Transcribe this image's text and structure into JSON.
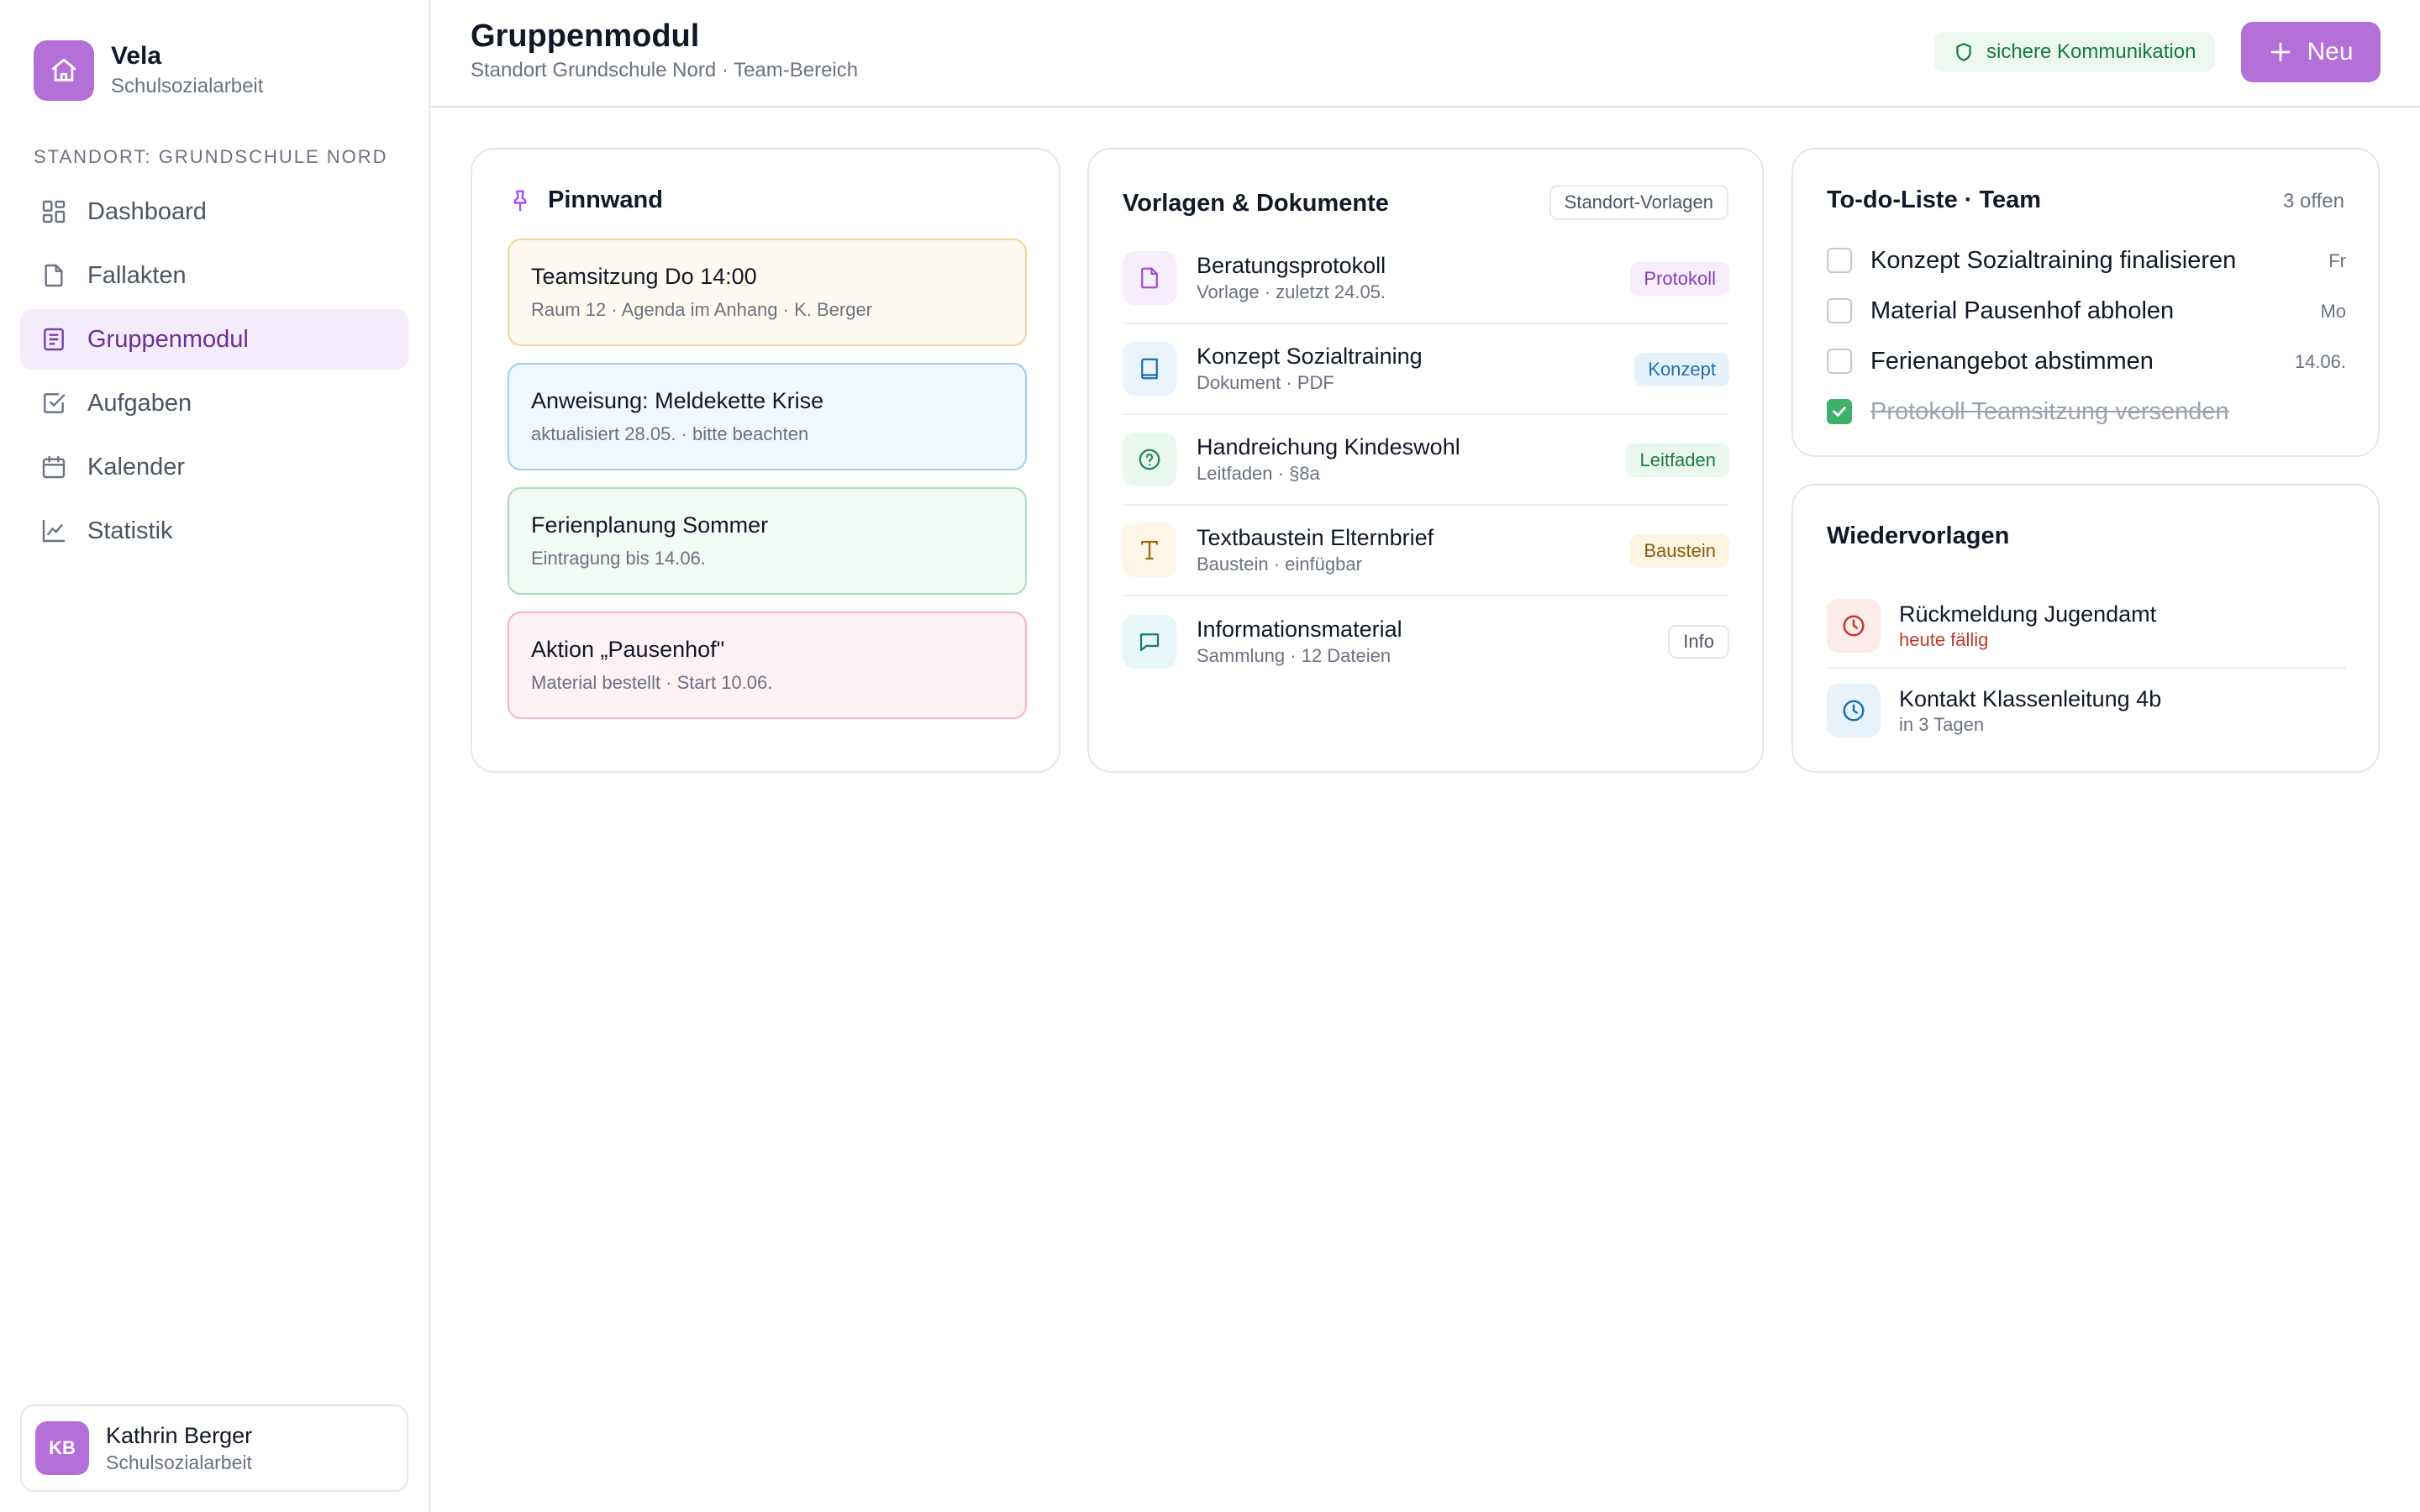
{
  "brand": {
    "name": "Vela",
    "subtitle": "Schulsozialarbeit",
    "accent": "#b46fd8"
  },
  "sidebar": {
    "section_label": "Standort: Grundschule Nord",
    "items": [
      {
        "label": "Dashboard",
        "icon": "dashboard-icon",
        "active": false
      },
      {
        "label": "Fallakten",
        "icon": "file-icon",
        "active": false
      },
      {
        "label": "Gruppenmodul",
        "icon": "group-module-icon",
        "active": true
      },
      {
        "label": "Aufgaben",
        "icon": "checklist-icon",
        "active": false
      },
      {
        "label": "Kalender",
        "icon": "calendar-icon",
        "active": false
      },
      {
        "label": "Statistik",
        "icon": "chart-icon",
        "active": false
      }
    ],
    "user": {
      "initials": "KB",
      "name": "Kathrin Berger",
      "role": "Schulsozialarbeit"
    }
  },
  "header": {
    "title": "Gruppenmodul",
    "subtitle": "Standort Grundschule Nord · Team-Bereich",
    "badge": "sichere Kommunikation",
    "new_button": "Neu"
  },
  "pinboard": {
    "title": "Pinnwand",
    "notes": [
      {
        "title": "Teamsitzung Do 14:00",
        "meta": "Raum 12 · Agenda im Anhang · K. Berger",
        "bg": "#fffaf1",
        "border": "#f6d49a"
      },
      {
        "title": "Anweisung: Meldekette Krise",
        "meta": "aktualisiert 28.05. · bitte beachten",
        "bg": "#f0f7fe",
        "border": "#9fcdf2"
      },
      {
        "title": "Ferienplanung Sommer",
        "meta": "Eintragung bis 14.06.",
        "bg": "#f1faf4",
        "border": "#a9dcbb"
      },
      {
        "title": "Aktion „Pausenhof\"",
        "meta": "Material bestellt · Start 10.06.",
        "bg": "#fff2f5",
        "border": "#f5b3c3"
      }
    ]
  },
  "documents": {
    "title": "Vorlagen & Dokumente",
    "chip": "Standort-Vorlagen",
    "rows": [
      {
        "name": "Beratungsprotokoll",
        "meta": "Vorlage · zuletzt 24.05.",
        "tag": "Protokoll",
        "icon": "document-icon",
        "icon_bg": "#f6eefc",
        "icon_color": "#9d4fd0",
        "tag_bg": "#f6eefc",
        "tag_color": "#8a3cba"
      },
      {
        "name": "Konzept Sozialtraining",
        "meta": "Dokument · PDF",
        "tag": "Konzept",
        "icon": "book-icon",
        "icon_bg": "#eaf4fc",
        "icon_color": "#1f6fae",
        "tag_bg": "#e6f2fb",
        "tag_color": "#1f6fae"
      },
      {
        "name": "Handreichung Kindeswohl",
        "meta": "Leitfaden · §8a",
        "tag": "Leitfaden",
        "icon": "help-circle-icon",
        "icon_bg": "#eaf7ef",
        "icon_color": "#1f8a4c",
        "tag_bg": "#e9f7ee",
        "tag_color": "#1f7a44"
      },
      {
        "name": "Textbaustein Elternbrief",
        "meta": "Baustein · einfügbar",
        "tag": "Baustein",
        "icon": "text-icon",
        "icon_bg": "#fdf5e6",
        "icon_color": "#9a6a12",
        "tag_bg": "#fdf5e3",
        "tag_color": "#8a5d0c"
      },
      {
        "name": "Informationsmaterial",
        "meta": "Sammlung · 12 Dateien",
        "tag": "Info",
        "icon": "message-icon",
        "icon_bg": "#e7f6f6",
        "icon_color": "#157a7a",
        "tag_bg": "#ffffff",
        "tag_color": "#4b5563"
      }
    ]
  },
  "todo": {
    "title": "To-do-Liste · Team",
    "count": "3 offen",
    "items": [
      {
        "label": "Konzept Sozialtraining finalisieren",
        "due": "Fr",
        "done": false
      },
      {
        "label": "Material Pausenhof abholen",
        "due": "Mo",
        "done": false
      },
      {
        "label": "Ferienangebot abstimmen",
        "due": "14.06.",
        "done": false
      },
      {
        "label": "Protokoll Teamsitzung versenden",
        "due": "",
        "done": true
      }
    ]
  },
  "reminders": {
    "title": "Wiedervorlagen",
    "items": [
      {
        "name": "Rückmeldung Jugendamt",
        "due": "heute fällig",
        "due_color": "#c0392b",
        "icon_bg": "#fdecea",
        "icon_color": "#c0392b"
      },
      {
        "name": "Kontakt Klassenleitung 4b",
        "due": "in 3 Tagen",
        "due_color": "#6b7280",
        "icon_bg": "#e8f2fb",
        "icon_color": "#1f6fae"
      }
    ]
  }
}
